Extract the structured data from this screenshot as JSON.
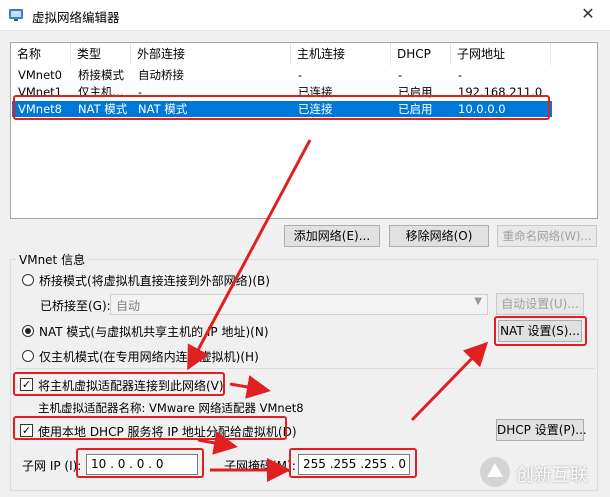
{
  "window": {
    "title": "虚拟网络编辑器",
    "close_glyph": "✕"
  },
  "network_list": {
    "columns": [
      "名称",
      "类型",
      "外部连接",
      "主机连接",
      "DHCP",
      "子网地址"
    ],
    "rows": [
      [
        "VMnet0",
        "桥接模式",
        "自动桥接",
        "-",
        "-",
        "-"
      ],
      [
        "VMnet1",
        "仅主机...",
        "-",
        "已连接",
        "已启用",
        "192.168.211.0"
      ],
      [
        "VMnet8",
        "NAT 模式",
        "NAT 模式",
        "已连接",
        "已启用",
        "10.0.0.0"
      ]
    ],
    "selected_index": 2
  },
  "list_buttons": {
    "add": "添加网络(E)...",
    "remove": "移除网络(O)",
    "rename": "重命名网络(W)..."
  },
  "vmnet_info": {
    "group_label": "VMnet 信息",
    "bridged_radio": "桥接模式(将虚拟机直接连接到外部网络)(B)",
    "bridged_to_label": "已桥接至(G):",
    "bridged_to_value": "自动",
    "auto_settings": "自动设置(U)...",
    "nat_radio": "NAT 模式(与虚拟机共享主机的 IP 地址)(N)",
    "nat_settings": "NAT 设置(S)...",
    "hostonly_radio": "仅主机模式(在专用网络内连接虚拟机)(H)",
    "selected_mode": "nat",
    "connect_adapter_check": "将主机虚拟适配器连接到此网络(V)",
    "adapter_name": "主机虚拟适配器名称: VMware 网络适配器 VMnet8",
    "dhcp_check": "使用本地 DHCP 服务将 IP 地址分配给虚拟机(D)",
    "dhcp_settings": "DHCP 设置(P)...",
    "subnet_ip_label": "子网 IP (I):",
    "subnet_ip_value": "10 . 0 . 0 . 0",
    "subnet_mask_label": "子网掩码(M):",
    "subnet_mask_value": "255 .255 .255 . 0",
    "check_glyph": "✓"
  },
  "watermark": {
    "text": "创新互联"
  },
  "colors": {
    "selection": "#0078d7",
    "annotation": "#e02020"
  }
}
